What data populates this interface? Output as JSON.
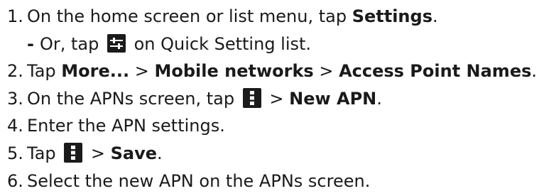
{
  "steps": [
    {
      "num": "1.",
      "parts": [
        {
          "text": "On the home screen or list menu, tap "
        },
        {
          "bold": "Settings"
        },
        {
          "text": "."
        }
      ]
    },
    {
      "num": "2.",
      "parts": [
        {
          "text": "Tap "
        },
        {
          "bold": "More..."
        },
        {
          "text": " > "
        },
        {
          "bold": "Mobile networks"
        },
        {
          "text": " > "
        },
        {
          "bold": "Access Point Names"
        },
        {
          "text": "."
        }
      ]
    },
    {
      "num": "3.",
      "before_icon": "On the APNs screen, tap ",
      "after_icon": " > ",
      "bold": "New APN",
      "end": "."
    },
    {
      "num": "4.",
      "text": "Enter the APN settings."
    },
    {
      "num": "5.",
      "before_icon": "Tap ",
      "after_icon": " > ",
      "bold": "Save",
      "end": "."
    },
    {
      "num": "6.",
      "text": "Select the new APN on the APNs screen."
    }
  ],
  "substep": {
    "dash": "-",
    "before_icon": "Or, tap ",
    "after_icon": " on Quick Setting list."
  },
  "icons": {
    "quick_settings": "quick-settings-sliders-icon",
    "menu": "overflow-menu-icon"
  }
}
